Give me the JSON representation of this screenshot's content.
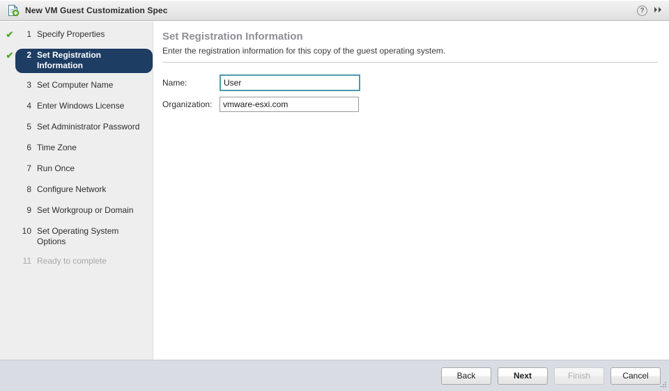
{
  "window": {
    "title": "New VM Guest Customization Spec",
    "icon": "new-document-icon",
    "help_icon": "?",
    "expand_icon": "▸▸",
    "accent_selected": "#1d3d63",
    "accent_check": "#55a630",
    "accent_focus": "#4c9aaa"
  },
  "sidebar": {
    "steps": [
      {
        "num": "1",
        "label": "Specify Properties",
        "check": "✔",
        "state": "done"
      },
      {
        "num": "2",
        "label": "Set Registration Information",
        "check": "✔",
        "state": "selected"
      },
      {
        "num": "3",
        "label": "Set Computer Name",
        "check": "",
        "state": "pending"
      },
      {
        "num": "4",
        "label": "Enter Windows License",
        "check": "",
        "state": "pending"
      },
      {
        "num": "5",
        "label": "Set Administrator Password",
        "check": "",
        "state": "pending"
      },
      {
        "num": "6",
        "label": "Time Zone",
        "check": "",
        "state": "pending"
      },
      {
        "num": "7",
        "label": "Run Once",
        "check": "",
        "state": "pending"
      },
      {
        "num": "8",
        "label": "Configure Network",
        "check": "",
        "state": "pending"
      },
      {
        "num": "9",
        "label": "Set Workgroup or Domain",
        "check": "",
        "state": "pending"
      },
      {
        "num": "10",
        "label": "Set Operating System Options",
        "check": "",
        "state": "pending"
      },
      {
        "num": "11",
        "label": "Ready to complete",
        "check": "",
        "state": "disabled"
      }
    ]
  },
  "main": {
    "title": "Set Registration Information",
    "subtitle": "Enter the registration information for this copy of the guest operating system.",
    "fields": [
      {
        "label": "Name:",
        "value": "User",
        "focused": true
      },
      {
        "label": "Organization:",
        "value": "vmware-esxi.com",
        "focused": false
      }
    ]
  },
  "footer": {
    "buttons": [
      {
        "label": "Back",
        "state": "normal"
      },
      {
        "label": "Next",
        "state": "default"
      },
      {
        "label": "Finish",
        "state": "disabled"
      },
      {
        "label": "Cancel",
        "state": "normal"
      }
    ]
  }
}
